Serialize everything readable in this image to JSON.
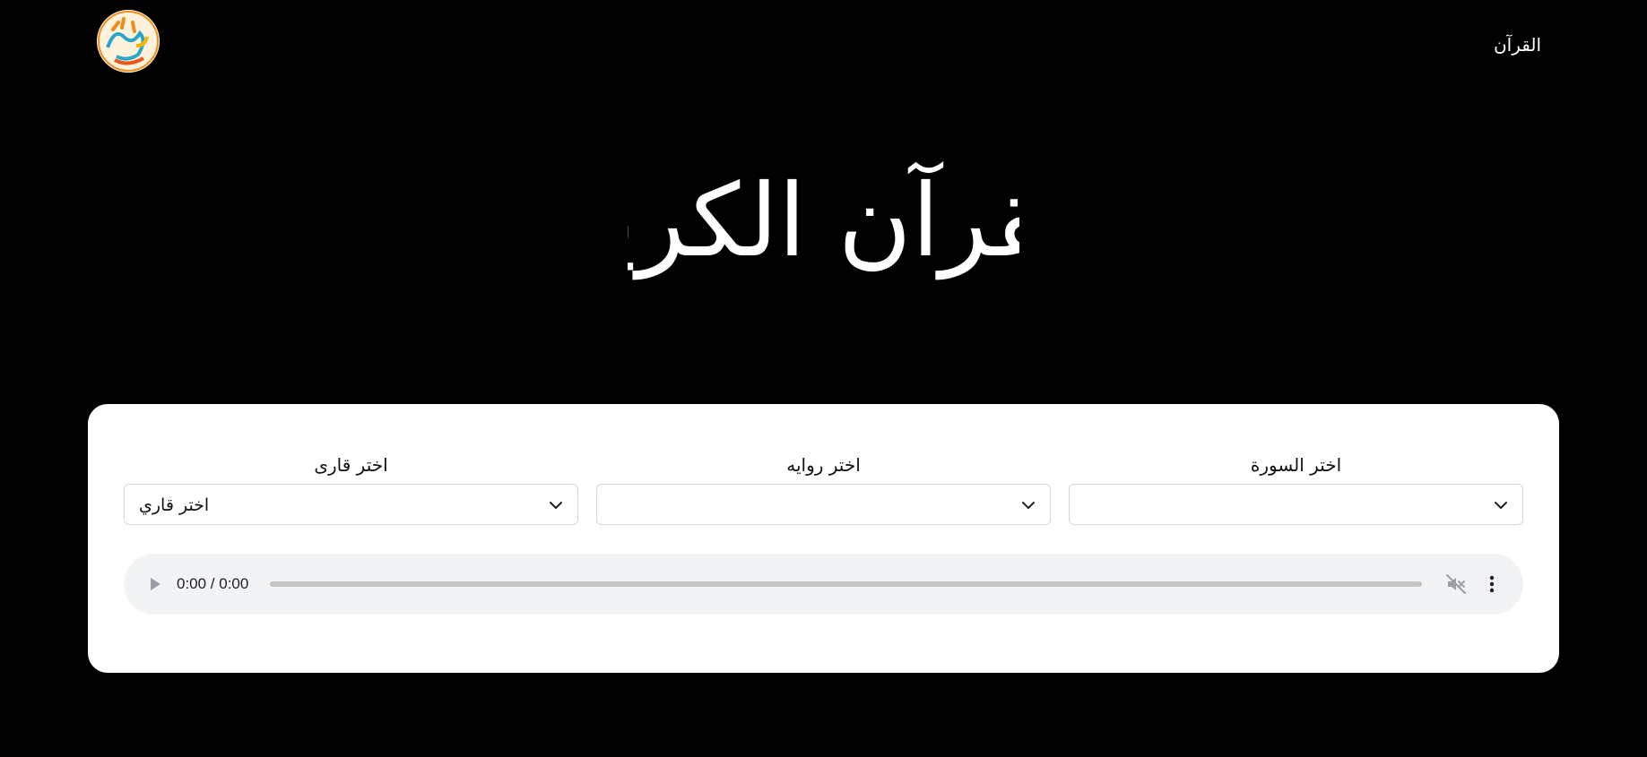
{
  "header": {
    "nav_link": "القرآن",
    "logo_icon": "quran-calligraphy-logo"
  },
  "hero": {
    "calligraphy": "القرآن الكريم"
  },
  "form": {
    "surah": {
      "label": "اختر السورة",
      "value": ""
    },
    "riwaya": {
      "label": "اختر روايه",
      "value": ""
    },
    "reciter": {
      "label": "اختر قارى",
      "value": "اختر قاري"
    }
  },
  "player": {
    "time": "0:00 / 0:00",
    "progress": 0,
    "icons": [
      "play-icon",
      "mute-icon",
      "more-vert-icon"
    ]
  },
  "colors": {
    "background": "#000000",
    "card": "#ffffff",
    "player_bg": "#f1f3f4"
  }
}
